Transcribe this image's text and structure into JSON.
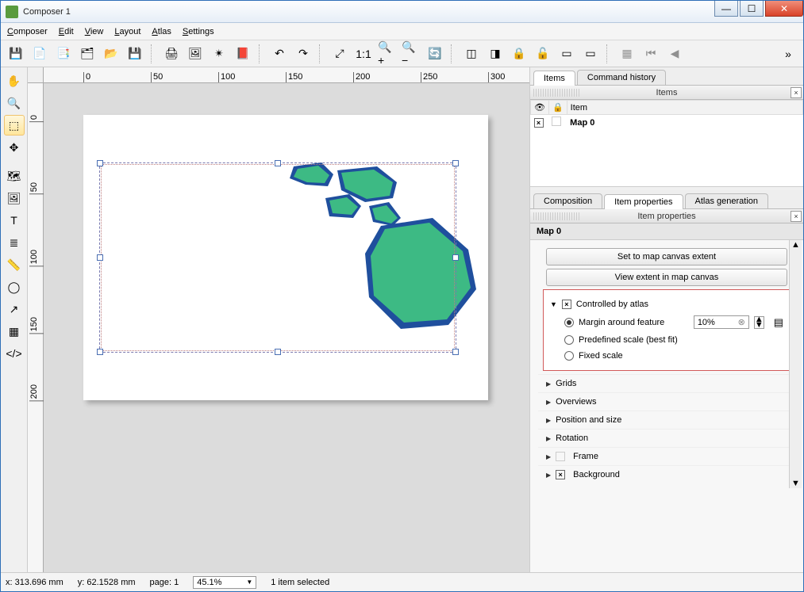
{
  "window": {
    "title": "Composer 1"
  },
  "menu": {
    "composer": "Composer",
    "edit": "Edit",
    "view": "View",
    "layout": "Layout",
    "atlas": "Atlas",
    "settings": "Settings"
  },
  "tabs": {
    "top": {
      "items": "Items",
      "command_history": "Command history"
    },
    "mid": {
      "composition": "Composition",
      "item_properties": "Item properties",
      "atlas_generation": "Atlas generation"
    }
  },
  "panels": {
    "items_title": "Items",
    "item_props_title": "Item properties"
  },
  "items_table": {
    "col_item": "Item",
    "rows": [
      {
        "name": "Map 0"
      }
    ]
  },
  "item_props": {
    "header": "Map 0",
    "btn_set_extent": "Set to map canvas extent",
    "btn_view_extent": "View extent in map canvas",
    "atlas": {
      "label": "Controlled by atlas",
      "margin_label": "Margin around feature",
      "margin_value": "10%",
      "predefined": "Predefined scale (best fit)",
      "fixed": "Fixed scale"
    },
    "sections": {
      "grids": "Grids",
      "overviews": "Overviews",
      "pos": "Position and size",
      "rotation": "Rotation",
      "frame": "Frame",
      "background": "Background"
    }
  },
  "ruler": {
    "h": [
      "0",
      "50",
      "100",
      "150",
      "200",
      "250",
      "300"
    ],
    "v": [
      "0",
      "50",
      "100",
      "150",
      "200"
    ]
  },
  "status": {
    "x": "x: 313.696 mm",
    "y": "y: 62.1528 mm",
    "page": "page: 1",
    "zoom": "45.1%",
    "sel": "1 item selected"
  },
  "icons": {
    "eye": "👁",
    "lock": "🔒"
  }
}
